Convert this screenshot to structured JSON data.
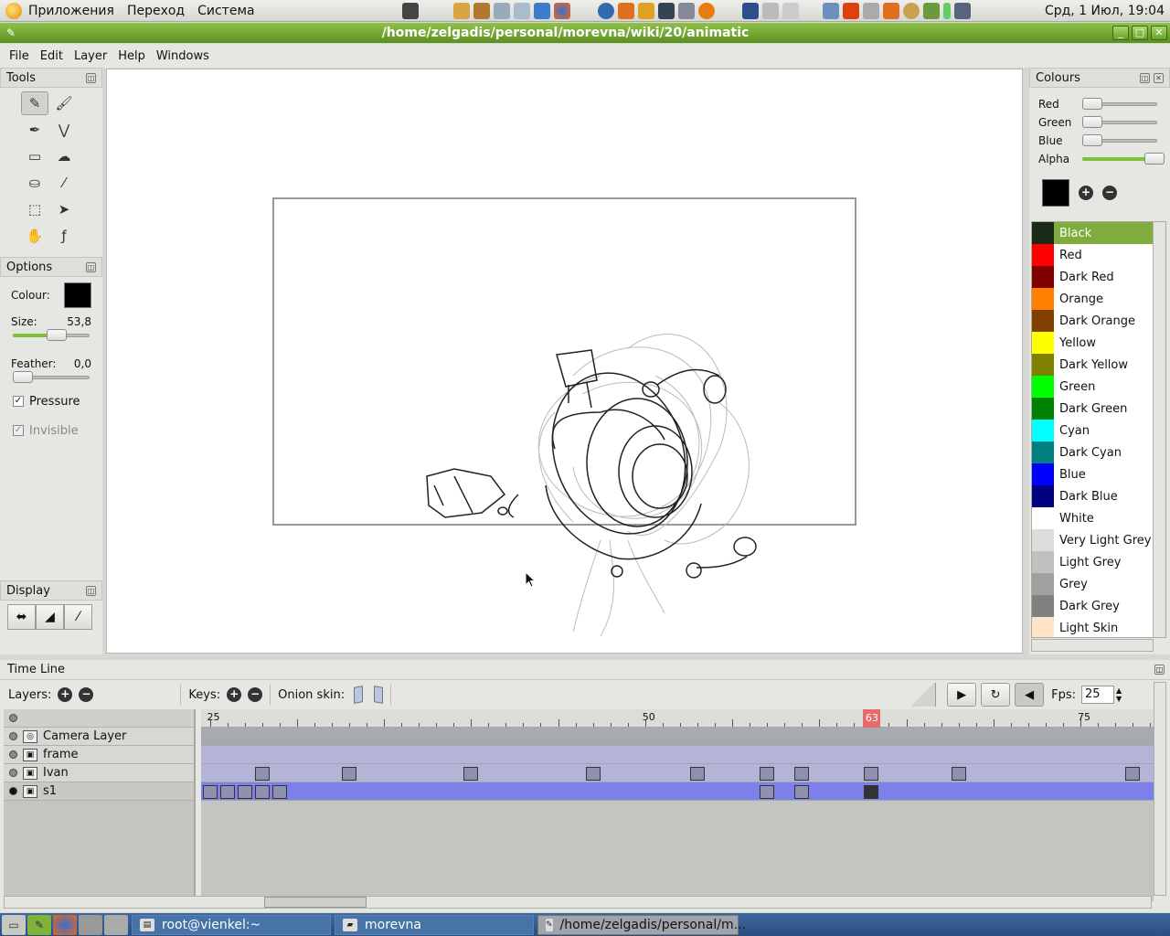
{
  "top_panel": {
    "menus": [
      "Приложения",
      "Переход",
      "Система"
    ],
    "clock": "Срд,  1 Июл, 19:04"
  },
  "window": {
    "title": "/home/zelgadis/personal/morevna/wiki/20/animatic"
  },
  "menubar": [
    "File",
    "Edit",
    "Layer",
    "Help",
    "Windows"
  ],
  "tools_dock": {
    "title": "Tools",
    "tools": [
      {
        "name": "pencil-icon",
        "glyph": "✎",
        "active": true
      },
      {
        "name": "brush-icon",
        "glyph": "🖌",
        "active": false
      },
      {
        "name": "pen-icon",
        "glyph": "✒",
        "active": false
      },
      {
        "name": "polyline-icon",
        "glyph": "⋁",
        "active": false
      },
      {
        "name": "eraser-icon",
        "glyph": "▭",
        "active": false
      },
      {
        "name": "smudge-icon",
        "glyph": "☁",
        "active": false
      },
      {
        "name": "bucket-icon",
        "glyph": "⛀",
        "active": false
      },
      {
        "name": "eyedropper-icon",
        "glyph": "⁄",
        "active": false
      },
      {
        "name": "select-icon",
        "glyph": "⬚",
        "active": false
      },
      {
        "name": "move-icon",
        "glyph": "➤",
        "active": false
      },
      {
        "name": "hand-icon",
        "glyph": "✋",
        "active": false
      },
      {
        "name": "edit-points-icon",
        "glyph": "ƒ",
        "active": false
      }
    ]
  },
  "options_dock": {
    "title": "Options",
    "colour_label": "Colour:",
    "size_label": "Size:",
    "size_value": "53,8",
    "size_level": 0.62,
    "feather_label": "Feather:",
    "feather_value": "0,0",
    "feather_level": 0.0,
    "pressure_label": "Pressure",
    "pressure_checked": true,
    "invisible_label": "Invisible",
    "invisible_checked": true
  },
  "display_dock": {
    "title": "Display"
  },
  "colours_dock": {
    "title": "Colours",
    "sliders": [
      {
        "label": "Red",
        "level": 0.0
      },
      {
        "label": "Green",
        "level": 0.0
      },
      {
        "label": "Blue",
        "level": 0.0
      },
      {
        "label": "Alpha",
        "level": 1.0
      }
    ],
    "palette": [
      {
        "name": "Black",
        "hex": "#1a2a18",
        "selected": true
      },
      {
        "name": "Red",
        "hex": "#ff0000"
      },
      {
        "name": "Dark Red",
        "hex": "#800000"
      },
      {
        "name": "Orange",
        "hex": "#ff8000"
      },
      {
        "name": "Dark Orange",
        "hex": "#804000"
      },
      {
        "name": "Yellow",
        "hex": "#ffff00"
      },
      {
        "name": "Dark Yellow",
        "hex": "#808000"
      },
      {
        "name": "Green",
        "hex": "#00ff00"
      },
      {
        "name": "Dark Green",
        "hex": "#008000"
      },
      {
        "name": "Cyan",
        "hex": "#00ffff"
      },
      {
        "name": "Dark Cyan",
        "hex": "#008080"
      },
      {
        "name": "Blue",
        "hex": "#0000ff"
      },
      {
        "name": "Dark Blue",
        "hex": "#000080"
      },
      {
        "name": "White",
        "hex": "#ffffff"
      },
      {
        "name": "Very Light Grey",
        "hex": "#dcdcdc"
      },
      {
        "name": "Light Grey",
        "hex": "#c0c0c0"
      },
      {
        "name": "Grey",
        "hex": "#a0a0a0"
      },
      {
        "name": "Dark Grey",
        "hex": "#808080"
      },
      {
        "name": "Light Skin",
        "hex": "#ffe4c8"
      }
    ]
  },
  "timeline": {
    "title": "Time Line",
    "layers_label": "Layers:",
    "keys_label": "Keys:",
    "onion_label": "Onion skin:",
    "fps_label": "Fps:",
    "fps_value": "25",
    "ruler_labels": [
      {
        "frame": 25,
        "text": "25"
      },
      {
        "frame": 50,
        "text": "50"
      },
      {
        "frame": 75,
        "text": "75"
      }
    ],
    "current_frame": 63,
    "current_frame_text": "63",
    "layers": [
      {
        "name": "Camera Layer",
        "type": "camera",
        "visible": false,
        "bar": "#a9aab0",
        "keys": []
      },
      {
        "name": "frame",
        "type": "bitmap",
        "visible": false,
        "bar": "#b4b4d8",
        "keys": []
      },
      {
        "name": "Ivan",
        "type": "bitmap",
        "visible": false,
        "bar": "#b4b4d8",
        "keys": [
          28,
          33,
          40,
          47,
          53,
          57,
          59,
          63,
          68,
          78
        ]
      },
      {
        "name": "s1",
        "type": "bitmap",
        "visible": true,
        "current": true,
        "bar": "#7e80ea",
        "keys": [
          25,
          26,
          27,
          28,
          29,
          57,
          59,
          63
        ]
      }
    ]
  },
  "bottom_panel": {
    "tasks": [
      {
        "label": "root@vienkel:~",
        "active": false
      },
      {
        "label": "morevna",
        "active": false
      },
      {
        "label": "/home/zelgadis/personal/m...",
        "active": true
      }
    ]
  }
}
